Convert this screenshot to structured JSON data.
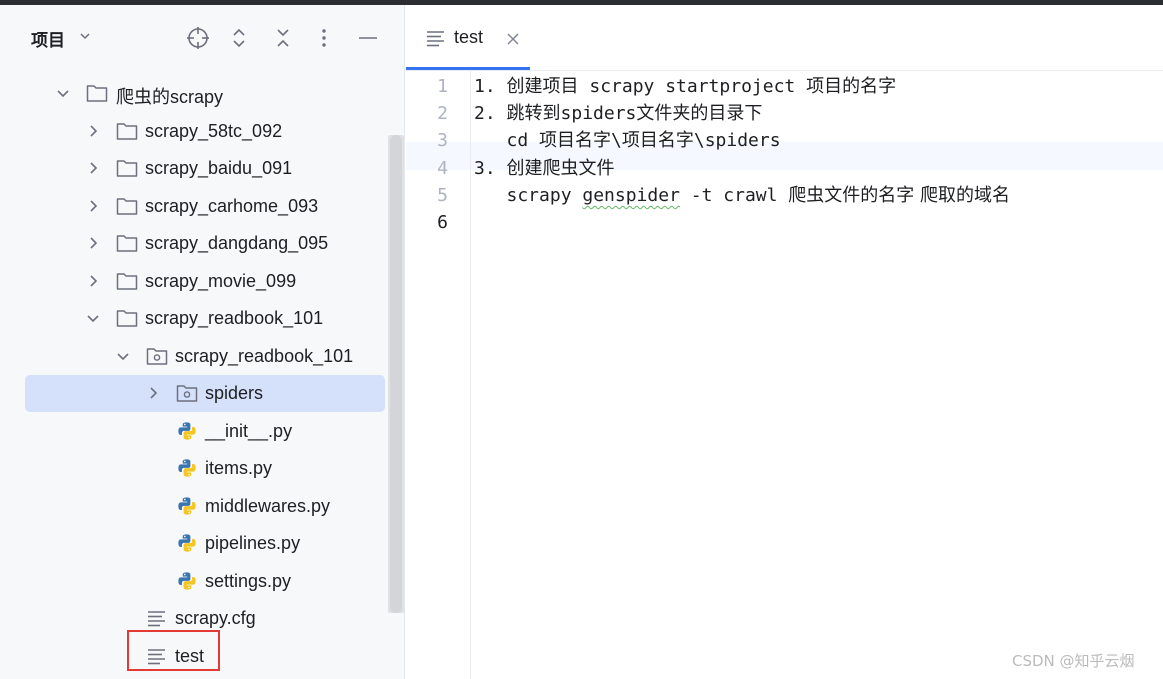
{
  "project_panel": {
    "title": "项目",
    "tree": [
      {
        "label": "爬虫的scrapy",
        "type": "folder",
        "expanded": true
      },
      {
        "label": "scrapy_58tc_092",
        "type": "folder",
        "expanded": false
      },
      {
        "label": "scrapy_baidu_091",
        "type": "folder",
        "expanded": false
      },
      {
        "label": "scrapy_carhome_093",
        "type": "folder",
        "expanded": false
      },
      {
        "label": "scrapy_dangdang_095",
        "type": "folder",
        "expanded": false
      },
      {
        "label": "scrapy_movie_099",
        "type": "folder",
        "expanded": false
      },
      {
        "label": "scrapy_readbook_101",
        "type": "folder",
        "expanded": true
      },
      {
        "label": "scrapy_readbook_101",
        "type": "package",
        "expanded": true
      },
      {
        "label": "spiders",
        "type": "package",
        "expanded": false,
        "selected": true
      },
      {
        "label": "__init__.py",
        "type": "python"
      },
      {
        "label": "items.py",
        "type": "python"
      },
      {
        "label": "middlewares.py",
        "type": "python"
      },
      {
        "label": "pipelines.py",
        "type": "python"
      },
      {
        "label": "settings.py",
        "type": "python"
      },
      {
        "label": "scrapy.cfg",
        "type": "text"
      },
      {
        "label": "test",
        "type": "text",
        "highlighted": true
      }
    ]
  },
  "editor": {
    "tab": {
      "label": "test"
    },
    "current_line": 6,
    "line_numbers": [
      "1",
      "2",
      "3",
      "4",
      "5",
      "6"
    ],
    "lines": [
      [
        "1. ",
        "创建项目",
        " scrapy startproject ",
        "项目的名字"
      ],
      [
        "2. ",
        "跳转到",
        "spiders",
        "文件夹的目录下"
      ],
      [
        "   cd ",
        "项目名字",
        "\\",
        "项目名字",
        "\\spiders"
      ],
      [
        "3. ",
        "创建爬虫文件"
      ],
      [
        "   scrapy ",
        "genspider",
        " -t crawl ",
        "爬虫文件的名字 爬取的域名"
      ],
      [
        ""
      ]
    ]
  },
  "watermark": "CSDN @知乎云烟",
  "colors": {
    "selection": "#d5e1fb",
    "tab_underline": "#3574f0",
    "highlight_box": "#e53935",
    "python_blue": "#3b75b0",
    "python_yellow": "#f3c623"
  }
}
